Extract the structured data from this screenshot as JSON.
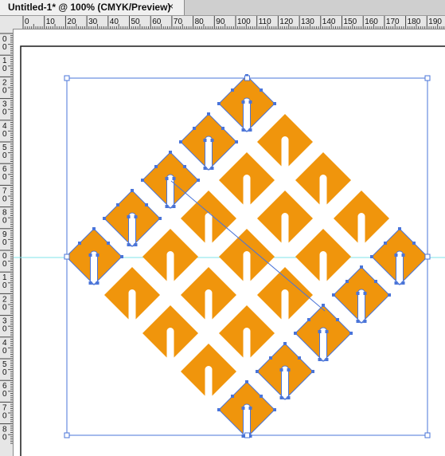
{
  "tab": {
    "title": "Untitled-1* @ 100% (CMYK/Preview)",
    "close_glyph": "×"
  },
  "ruler": {
    "h_labels": [
      "0",
      "10",
      "20",
      "30",
      "40",
      "50",
      "60",
      "70",
      "80",
      "90",
      "100",
      "110",
      "120",
      "130",
      "140",
      "150",
      "160",
      "170",
      "180",
      "190"
    ],
    "v_labels": [
      "0",
      "1",
      "2",
      "3",
      "4",
      "5",
      "6",
      "7",
      "8",
      "9",
      "0",
      "1",
      "2",
      "3",
      "4",
      "5",
      "6",
      "7",
      "8"
    ]
  },
  "colors": {
    "fill": "#f0950c",
    "selection": "#4a74d8",
    "guide": "#7fe3ea",
    "artboard": "#1a1a1a"
  },
  "icons": [
    "close-icon"
  ]
}
